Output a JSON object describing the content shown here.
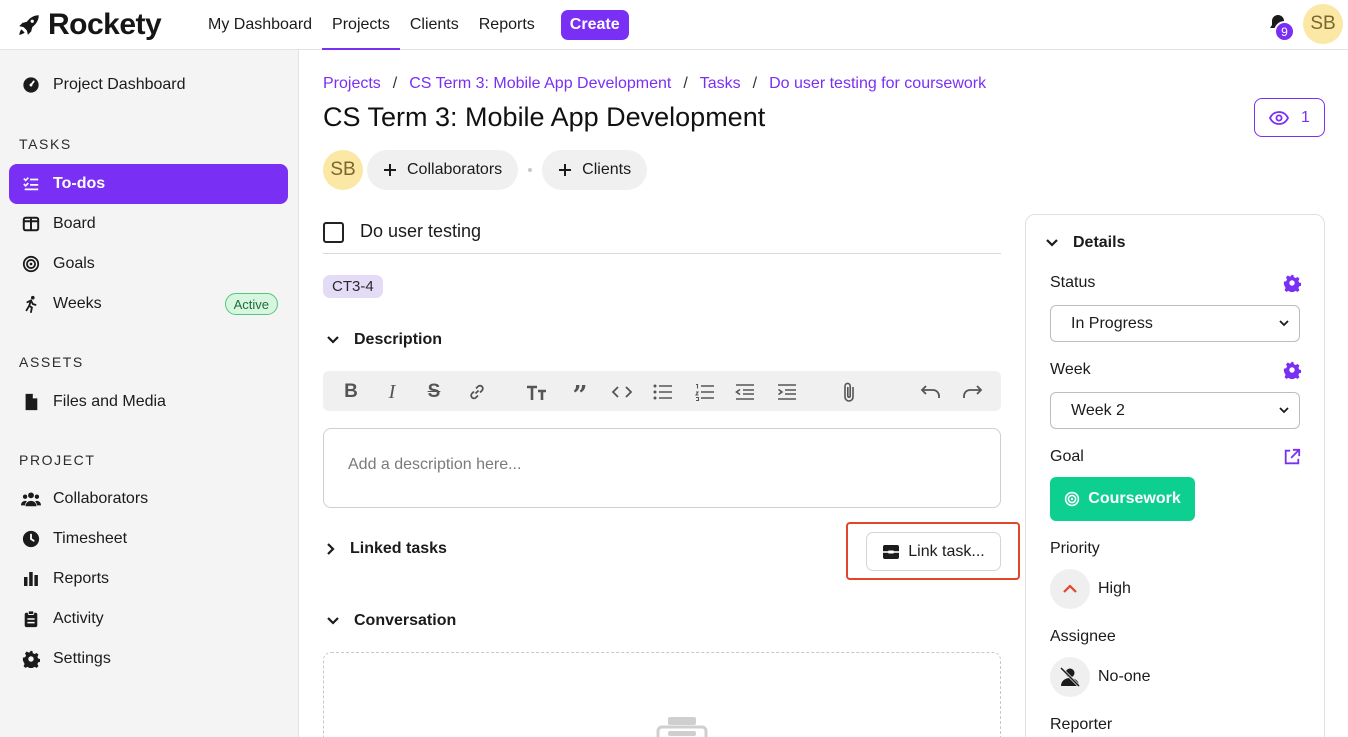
{
  "app": {
    "name": "Rockety",
    "notifications_count": "9",
    "user_initials": "SB"
  },
  "topnav": {
    "items": [
      {
        "label": "My Dashboard",
        "active": false
      },
      {
        "label": "Projects",
        "active": true
      },
      {
        "label": "Clients",
        "active": false
      },
      {
        "label": "Reports",
        "active": false
      }
    ],
    "create_label": "Create"
  },
  "sidebar": {
    "dashboard_label": "Project Dashboard",
    "tasks_heading": "TASKS",
    "tasks_items": [
      {
        "label": "To-dos",
        "icon": "todo-list-icon",
        "active": true
      },
      {
        "label": "Board",
        "icon": "board-icon",
        "active": false
      },
      {
        "label": "Goals",
        "icon": "target-icon",
        "active": false
      },
      {
        "label": "Weeks",
        "icon": "runner-icon",
        "active": false,
        "badge": "Active"
      }
    ],
    "assets_heading": "ASSETS",
    "assets_items": [
      {
        "label": "Files and Media",
        "icon": "file-icon"
      }
    ],
    "project_heading": "PROJECT",
    "project_items": [
      {
        "label": "Collaborators",
        "icon": "people-icon"
      },
      {
        "label": "Timesheet",
        "icon": "clock-icon"
      },
      {
        "label": "Reports",
        "icon": "bar-chart-icon"
      },
      {
        "label": "Activity",
        "icon": "clipboard-icon"
      },
      {
        "label": "Settings",
        "icon": "gear-icon"
      }
    ]
  },
  "breadcrumb": [
    "Projects",
    "CS Term 3: Mobile App Development",
    "Tasks",
    "Do user testing for coursework"
  ],
  "page_title": "CS Term 3: Mobile App Development",
  "watchers_count": "1",
  "people": {
    "owner_initials": "SB",
    "collaborators_label": "Collaborators",
    "clients_label": "Clients"
  },
  "task": {
    "name": "Do user testing",
    "key": "CT3-4",
    "description_heading": "Description",
    "description_placeholder": "Add a description here...",
    "linked_tasks_heading": "Linked tasks",
    "link_task_label": "Link task...",
    "conversation_heading": "Conversation"
  },
  "details": {
    "heading": "Details",
    "status_label": "Status",
    "status_value": "In Progress",
    "week_label": "Week",
    "week_value": "Week 2",
    "goal_label": "Goal",
    "goal_value": "Coursework",
    "priority_label": "Priority",
    "priority_value": "High",
    "assignee_label": "Assignee",
    "assignee_value": "No-one",
    "reporter_label": "Reporter"
  },
  "colors": {
    "accent": "#7a2ff5",
    "goal": "#0ccf90",
    "priority_high": "#e2462a",
    "highlight": "#e2462a"
  }
}
